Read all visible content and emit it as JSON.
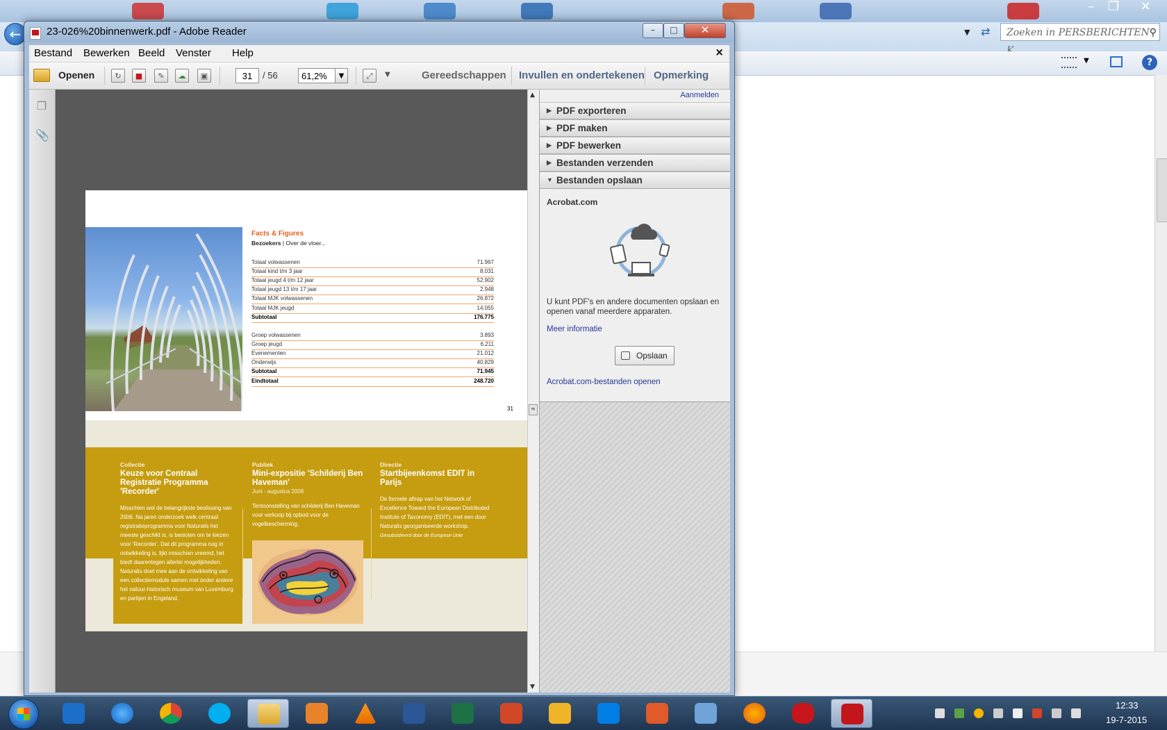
{
  "background": {
    "search_placeholder": "Zoeken in PERSBERICHTEN K..."
  },
  "window": {
    "title": "23-026%20binnenwerk.pdf - Adobe Reader"
  },
  "menu": [
    "Bestand",
    "Bewerken",
    "Beeld",
    "Venster",
    "Help"
  ],
  "toolbar": {
    "open_label": "Openen",
    "page_current": "31",
    "page_total": "/ 56",
    "zoom": "61,2%",
    "tools_label": "Gereedschappen",
    "fill_sign_label": "Invullen en ondertekenen",
    "comment_label": "Opmerking"
  },
  "document": {
    "section_title": "Facts & Figures",
    "section_sub_bold": "Bezoekers",
    "section_sub": " | Over de vloer...",
    "rows_a": [
      {
        "label": "Totaal volwassenen",
        "value": "71.967"
      },
      {
        "label": "Totaal kind t/m 3 jaar",
        "value": "8.031"
      },
      {
        "label": "Totaal jeugd 4 t/m 12 jaar",
        "value": "52.902"
      },
      {
        "label": "Totaal jeugd 13 t/m 17 jaar",
        "value": "2.948"
      },
      {
        "label": "Totaal MJK volwassenen",
        "value": "26.872"
      },
      {
        "label": "Totaal MJK jeugd",
        "value": "14.055"
      },
      {
        "label": "Subtotaal",
        "value": "176.775"
      }
    ],
    "rows_b": [
      {
        "label": "Groep volwassenen",
        "value": "3.893"
      },
      {
        "label": "Groep jeugd",
        "value": "6.211"
      },
      {
        "label": "Evenementen",
        "value": "21.012"
      },
      {
        "label": "Onderwijs",
        "value": "40.829"
      },
      {
        "label": "Subtotaal",
        "value": "71.945"
      },
      {
        "label": "Eindtotaal",
        "value": "248.720"
      }
    ],
    "page_number": "31",
    "columns": [
      {
        "category": "Collectie",
        "heading": "Keuze voor Centraal Registratie Programma 'Recorder'",
        "body": "Misschien wel de belangrijkste beslissing van 2006. Na jaren onderzoek welk centraal registratieprogramma voor Naturalis het meeste geschikt is, is besloten om te kiezen voor 'Recorder'. Dat dit programma nog in ontwikkeling is, lijkt misschien vreemd, het biedt daarentegen allerlei mogelijkheden. Naturalis doet mee aan de ontwikkeling van een collectiemodule samen met onder andere het natuur-historisch museum van Luxemburg en partijen in Engeland."
      },
      {
        "category": "Publiek",
        "heading": "Mini-expositie 'Schilderij Ben Haveman'",
        "date": "Juni - augustus 2006",
        "body": "Tentoonstelling van schilderij Ben Haveman voor verkoop bij opbod voor de vogelbescherming."
      },
      {
        "category": "Directie",
        "heading": "Startbijeenkomst EDIT in Parijs",
        "body": "De formele aftrap van het Network of Excellence Toward the European Distributed Institute of Taxonomy (EDIT), met een door Naturalis georganiseerde workshop.",
        "note": "Gesubsidieerd door de Europese Unie"
      }
    ]
  },
  "right_panel": {
    "signin": "Aanmelden",
    "sections": [
      "PDF exporteren",
      "PDF maken",
      "PDF bewerken",
      "Bestanden verzenden",
      "Bestanden opslaan"
    ],
    "acrobat_title": "Acrobat.com",
    "acrobat_text": "U kunt PDF's en andere documenten opslaan en openen vanaf meerdere apparaten.",
    "more_info": "Meer informatie",
    "save_button": "Opslaan",
    "open_files": "Acrobat.com-bestanden openen"
  },
  "taskbar": {
    "time": "12:33",
    "date": "19-7-2015"
  },
  "colors": {
    "accent_orange": "#e0651f",
    "gold": "#c69d10",
    "link_blue": "#23399b"
  }
}
